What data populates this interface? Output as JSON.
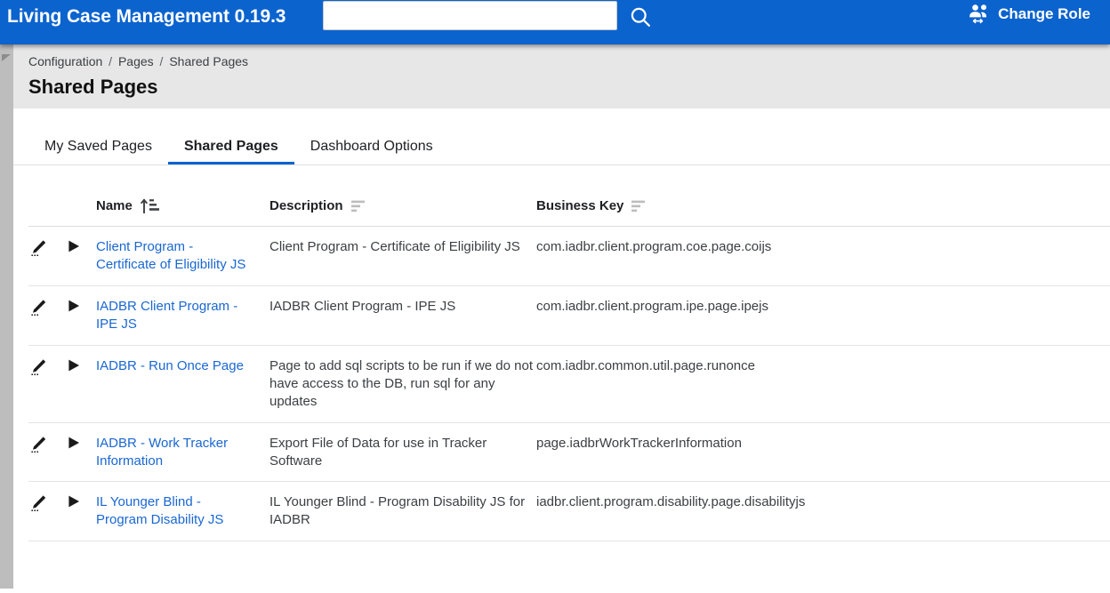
{
  "appbar": {
    "title": "Living Case Management 0.19.3",
    "search": {
      "value": "",
      "placeholder": ""
    },
    "search_icon": "search-icon",
    "change_role_label": "Change Role",
    "change_role_icon": "change-role-people-icon",
    "brand_color": "#0b63ce"
  },
  "page_head": {
    "breadcrumb": [
      "Configuration",
      "Pages",
      "Shared Pages"
    ],
    "breadcrumb_separator": "/",
    "title": "Shared Pages",
    "rail_toggle_icon": "collapse-arrow-icon"
  },
  "tabs": [
    {
      "label": "My Saved Pages",
      "active": false
    },
    {
      "label": "Shared Pages",
      "active": true
    },
    {
      "label": "Dashboard Options",
      "active": false
    }
  ],
  "table": {
    "columns": [
      {
        "key": "edit",
        "label": ""
      },
      {
        "key": "run",
        "label": ""
      },
      {
        "key": "name",
        "label": "Name",
        "sort_icon": "sort-ascending-icon",
        "sorted": true
      },
      {
        "key": "description",
        "label": "Description",
        "sort_icon": "sort-icon",
        "sorted": false
      },
      {
        "key": "business_key",
        "label": "Business Key",
        "sort_icon": "sort-icon",
        "sorted": false
      }
    ],
    "row_icons": {
      "edit": "pencil-icon",
      "run": "play-triangle-icon"
    },
    "rows": [
      {
        "name": "Client Program - Certificate of Eligibility JS",
        "description": "Client Program - Certificate of Eligibility JS",
        "business_key": "com.iadbr.client.program.coe.page.coijs"
      },
      {
        "name": "IADBR Client Program - IPE JS",
        "description": "IADBR Client Program - IPE JS",
        "business_key": "com.iadbr.client.program.ipe.page.ipejs"
      },
      {
        "name": "IADBR - Run Once Page",
        "description": "Page to add sql scripts to be run if we do not have access to the DB, run sql for any updates",
        "business_key": "com.iadbr.common.util.page.runonce"
      },
      {
        "name": "IADBR - Work Tracker Information",
        "description": "Export File of Data for use in Tracker Software",
        "business_key": "page.iadbrWorkTrackerInformation"
      },
      {
        "name": "IL Younger Blind - Program Disability JS",
        "description": "IL Younger Blind - Program Disability JS for IADBR",
        "business_key": "iadbr.client.program.disability.page.disabilityjs"
      }
    ]
  }
}
